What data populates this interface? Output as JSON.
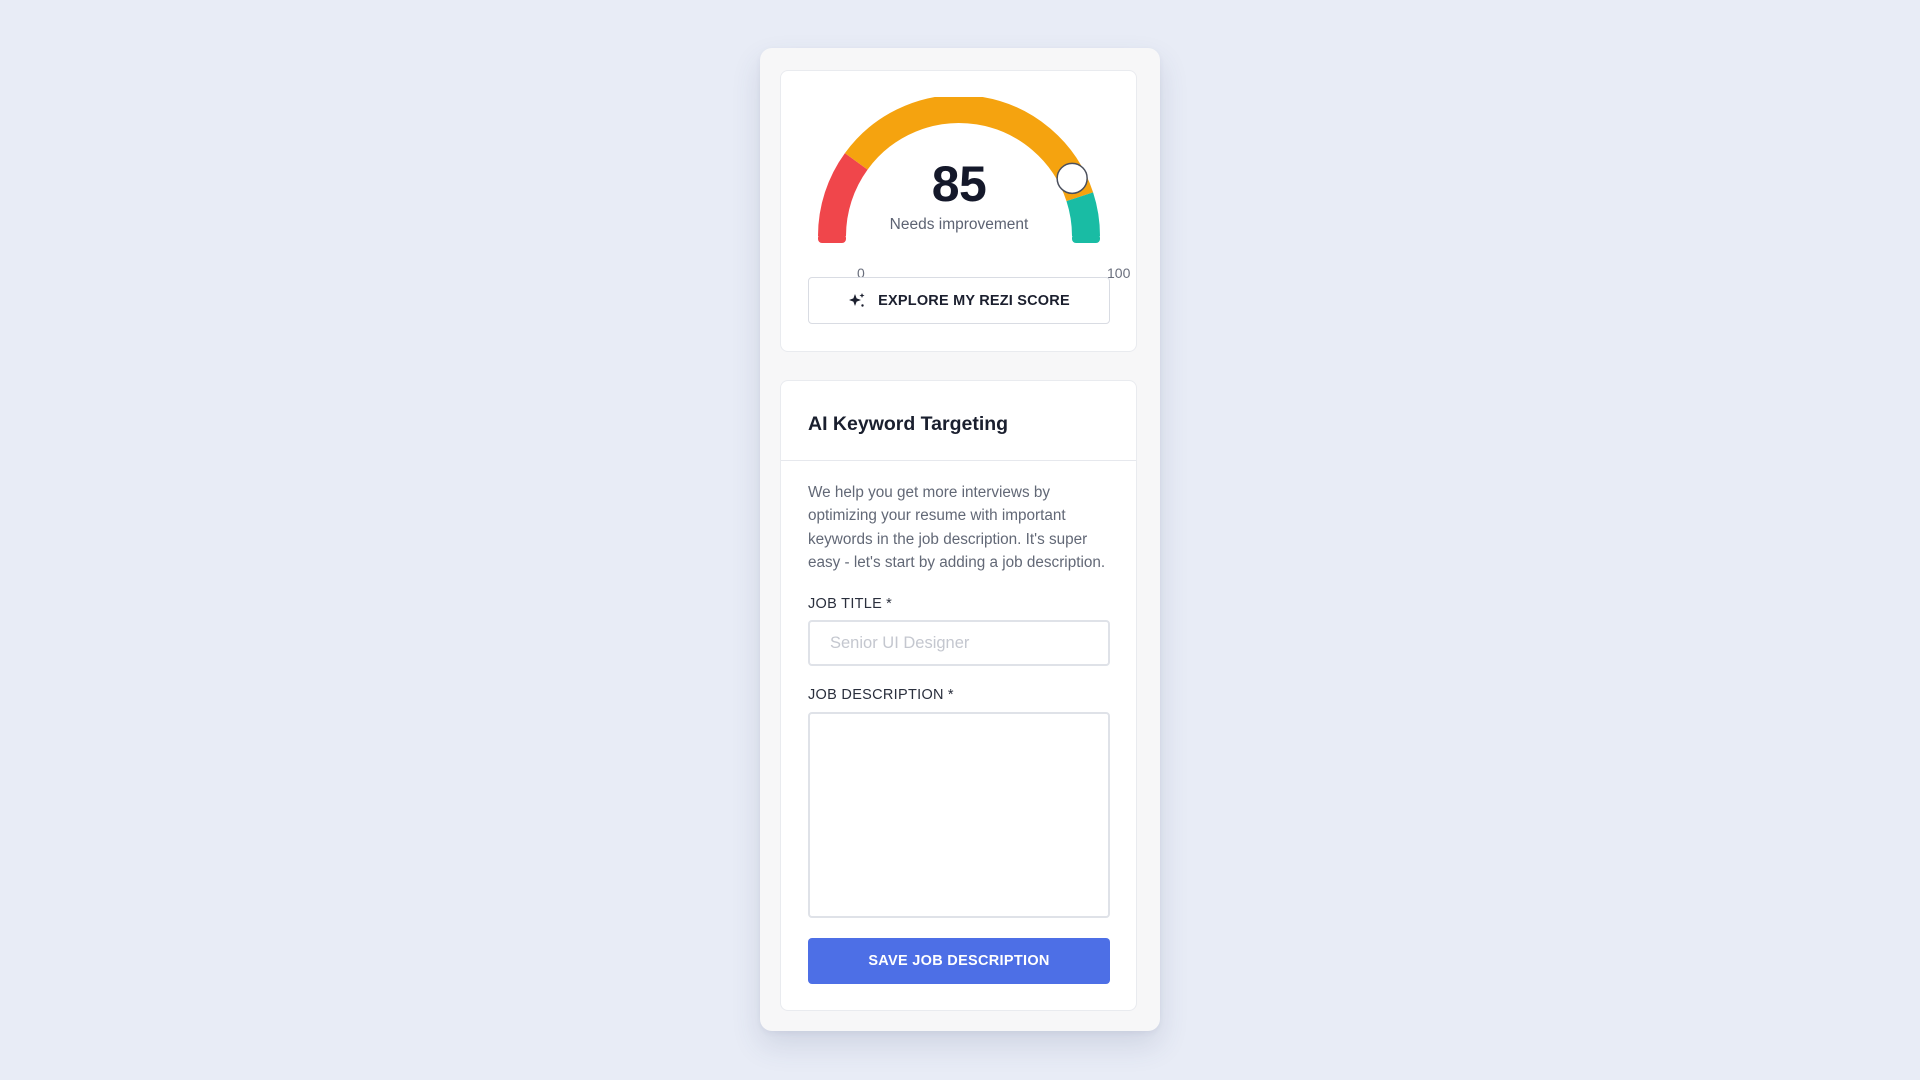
{
  "score": {
    "value": "85",
    "status": "Needs improvement",
    "min_label": "0",
    "max_label": "100",
    "level": 85,
    "segments": [
      {
        "name": "low",
        "color": "#f0464b",
        "from": 0,
        "to": 20
      },
      {
        "name": "mid",
        "color": "#f5a30f",
        "from": 20,
        "to": 90
      },
      {
        "name": "high",
        "color": "#19bca4",
        "from": 90,
        "to": 100
      }
    ],
    "explore_button": {
      "label": "EXPLORE MY REZI SCORE",
      "icon": "sparkle-icon"
    }
  },
  "keyword_targeting": {
    "title": "AI Keyword Targeting",
    "description": "We help you get more interviews by optimizing your resume with important keywords in the job description. It's super easy - let's start by adding a job description.",
    "job_title": {
      "label": "JOB TITLE",
      "required_mark": "*",
      "placeholder": "Senior UI Designer",
      "value": ""
    },
    "job_description": {
      "label": "JOB DESCRIPTION",
      "required_mark": "*",
      "value": ""
    },
    "save_button": {
      "label": "SAVE JOB DESCRIPTION"
    }
  },
  "colors": {
    "accent": "#4d6fe6",
    "background": "#e8ecf6"
  }
}
